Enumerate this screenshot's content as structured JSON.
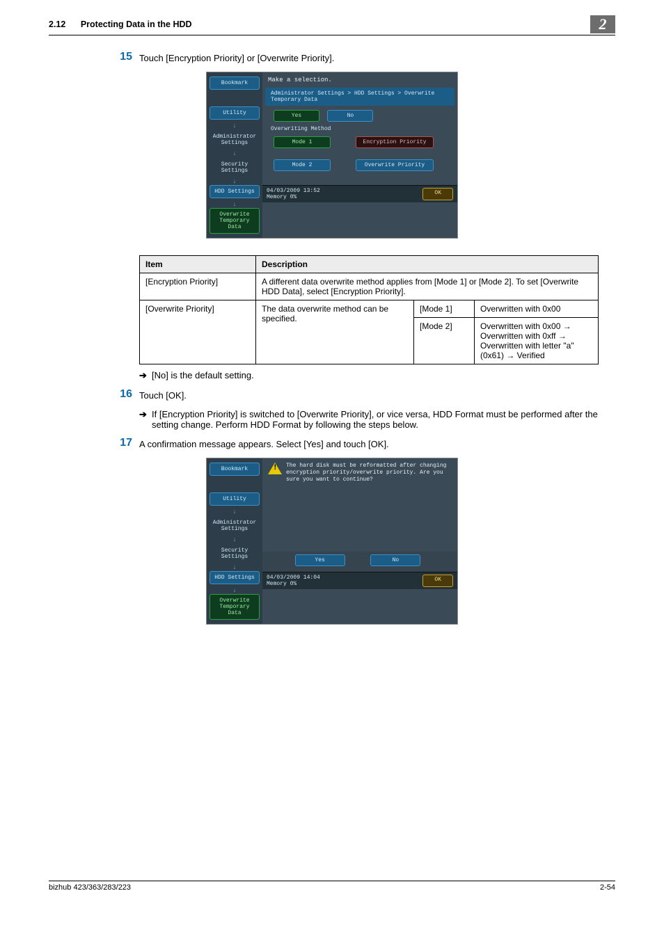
{
  "header": {
    "section_number": "2.12",
    "section_title": "Protecting Data in the HDD",
    "chapter_badge": "2"
  },
  "steps": {
    "s15": {
      "num": "15",
      "text": "Touch [Encryption Priority] or [Overwrite Priority]."
    },
    "s16": {
      "num": "16",
      "text": "Touch [OK].",
      "sub": "If [Encryption Priority] is switched to [Overwrite Priority], or vice versa, HDD Format must be performed after the setting change. Perform HDD Format by following the steps below."
    },
    "s17": {
      "num": "17",
      "text": "A confirmation message appears. Select [Yes] and touch [OK]."
    },
    "note15": "[No] is the default setting."
  },
  "shot1": {
    "title": "Make a selection.",
    "breadcrumb": "Administrator Settings > HDD Settings > Overwrite Temporary Data",
    "yes": "Yes",
    "no": "No",
    "section_label": "Overwriting Method",
    "mode1": "Mode 1",
    "mode2": "Mode 2",
    "enc": "Encryption Priority",
    "ovr": "Overwrite Priority",
    "ok": "OK",
    "status_l": "04/03/2009   13:52",
    "status_m": "Memory        0%",
    "side": {
      "bookmark": "Bookmark",
      "utility": "Utility",
      "admin": "Administrator Settings",
      "security": "Security Settings",
      "hdd": "HDD Settings",
      "ovr": "Overwrite Temporary Data"
    }
  },
  "table": {
    "h_item": "Item",
    "h_desc": "Description",
    "r1_item": "[Encryption Priority]",
    "r1_desc": "A different data overwrite method applies from [Mode 1] or [Mode 2]. To set [Overwrite HDD Data], select [Encryption Priority].",
    "r2_item": "[Overwrite Priority]",
    "r2_desc": "The data overwrite method can be specified.",
    "r2_m1": "[Mode 1]",
    "r2_m1_desc": "Overwritten with 0x00",
    "r2_m2": "[Mode 2]",
    "r2_m2_desc": "Overwritten with 0x00 → Overwritten with 0xff → Overwritten with letter \"a\" (0x61) → Verified"
  },
  "shot2": {
    "msg": "The hard disk must be reformatted after changing encryption priority/overwrite priority. Are you sure you want to continue?",
    "yes": "Yes",
    "no": "No",
    "ok": "OK",
    "status_l": "04/03/2009   14:04",
    "status_m": "Memory        0%"
  },
  "footer": {
    "left": "bizhub 423/363/283/223",
    "right": "2-54"
  }
}
